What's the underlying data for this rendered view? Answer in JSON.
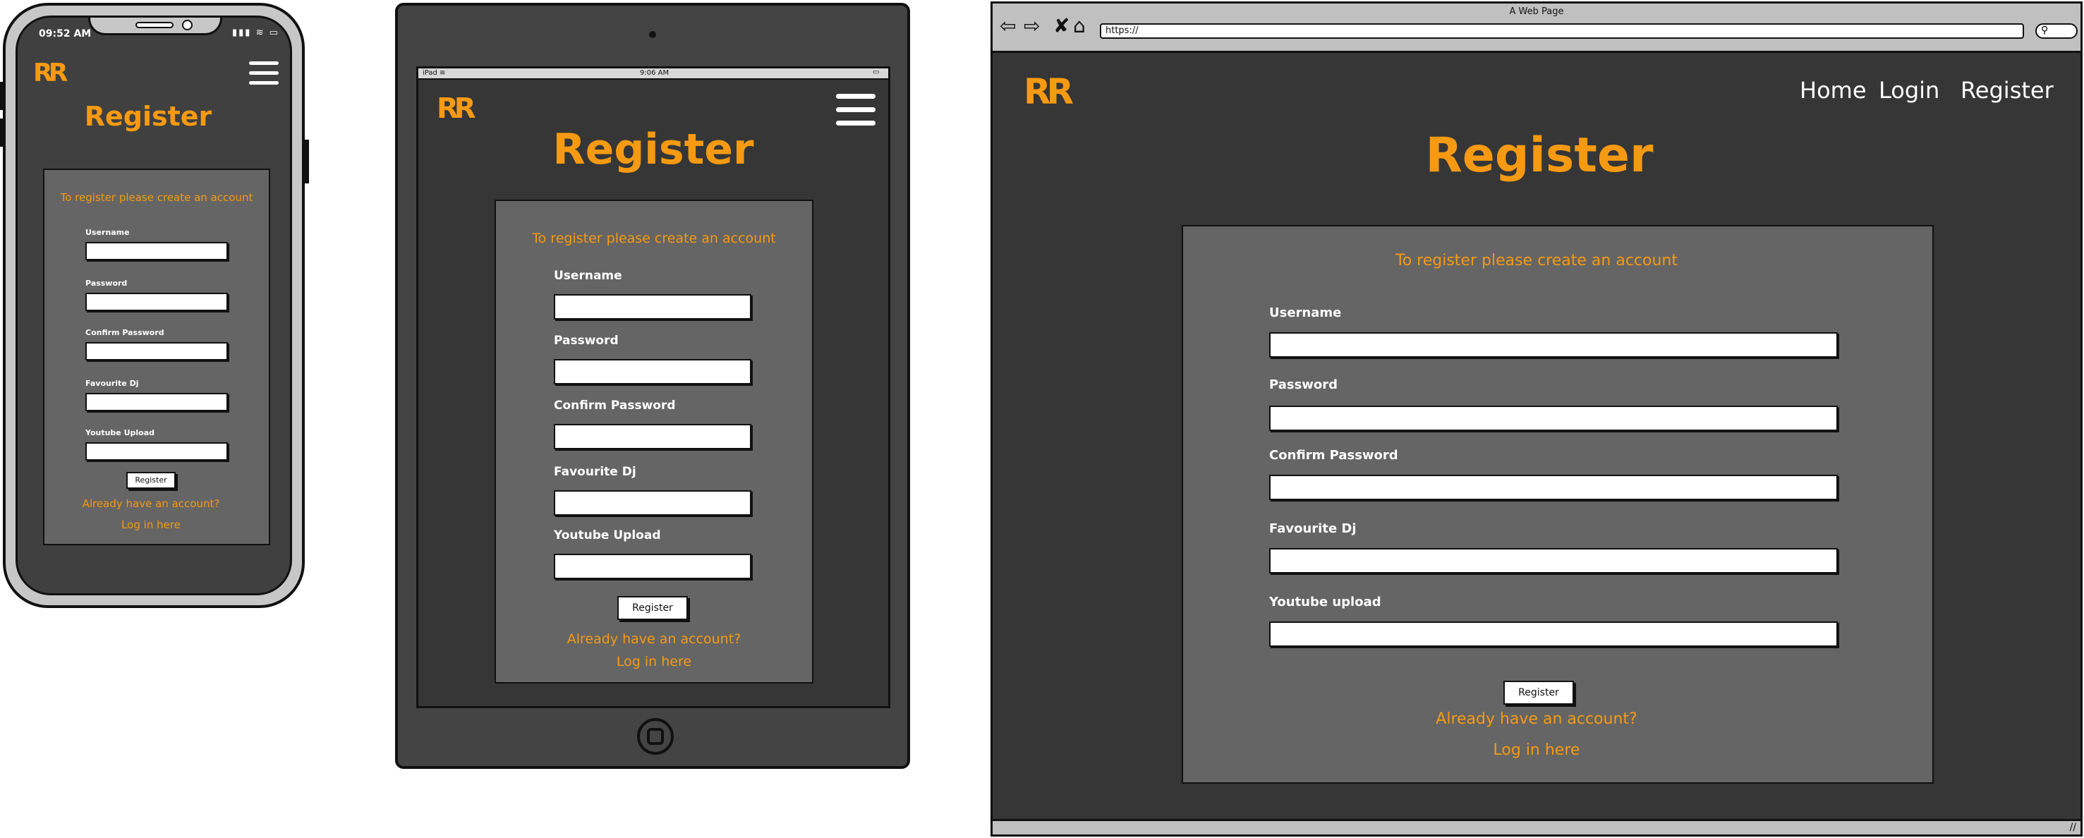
{
  "brand": {
    "logo": "RR"
  },
  "phone": {
    "status_time": "09:52 AM",
    "status_icons": "▮▮▮ ≋ ▭",
    "title": "Register",
    "form": {
      "heading": "To register please create an account",
      "fields": [
        "Username",
        "Password",
        "Confirm Password",
        "Favourite Dj",
        "Youtube Upload"
      ],
      "submit": "Register",
      "login_prompt": "Already have an account?",
      "login_link": "Log in here"
    }
  },
  "tablet": {
    "status_left": "iPad ≋",
    "status_time": "9:06 AM",
    "status_right": "▭",
    "title": "Register",
    "form": {
      "heading": "To register please create an account",
      "fields": [
        "Username",
        "Password",
        "Confirm Password",
        "Favourite Dj",
        "Youtube Upload"
      ],
      "submit": "Register",
      "login_prompt": "Already have an account?",
      "login_link": "Log in here"
    }
  },
  "browser": {
    "window_title": "A Web Page",
    "url": "https://",
    "nav": [
      "Home",
      "Login",
      "Register"
    ],
    "title": "Register",
    "form": {
      "heading": "To register please create an account",
      "fields": [
        "Username",
        "Password",
        "Confirm Password",
        "Favourite Dj",
        "Youtube upload"
      ],
      "submit": "Register",
      "login_prompt": "Already have an account?",
      "login_link": "Log in here"
    }
  },
  "colors": {
    "accent": "#f59a12",
    "panel": "#656565",
    "background": "#363636"
  },
  "icons": [
    "back-arrow-icon",
    "forward-arrow-icon",
    "stop-icon",
    "home-icon",
    "search-icon",
    "hamburger-menu-icon"
  ]
}
